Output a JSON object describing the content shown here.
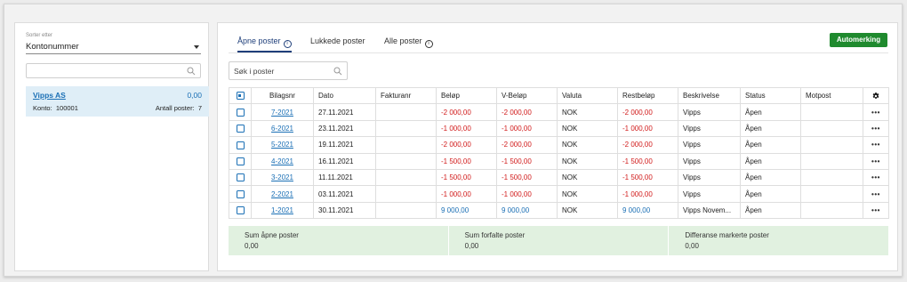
{
  "sidebar": {
    "sort_label": "Sorter etter",
    "sort_value": "Kontonummer",
    "search_placeholder": "",
    "account": {
      "name": "Vipps AS",
      "sum": "0,00",
      "konto_label": "Konto:",
      "konto_value": "100001",
      "count_label": "Antall poster:",
      "count_value": "7"
    }
  },
  "tabs": [
    {
      "label": "Åpne poster",
      "active": true,
      "info_icon": true
    },
    {
      "label": "Lukkede poster",
      "active": false,
      "info_icon": false
    },
    {
      "label": "Alle poster",
      "active": false,
      "info_icon": true
    }
  ],
  "info_glyph": "i",
  "automerking_label": "Automerking",
  "search_placeholder": "Søk i poster",
  "table": {
    "headers": [
      "Bilagsnr",
      "Dato",
      "Fakturanr",
      "Beløp",
      "V-Beløp",
      "Valuta",
      "Restbeløp",
      "Beskrivelse",
      "Status",
      "Motpost"
    ],
    "rows": [
      {
        "bilagsnr": "7-2021",
        "dato": "27.11.2021",
        "fakturanr": "",
        "belop": "-2 000,00",
        "vbelop": "-2 000,00",
        "valuta": "NOK",
        "restbelop": "-2 000,00",
        "beskrivelse": "Vipps",
        "status": "Åpen",
        "motpost": ""
      },
      {
        "bilagsnr": "6-2021",
        "dato": "23.11.2021",
        "fakturanr": "",
        "belop": "-1 000,00",
        "vbelop": "-1 000,00",
        "valuta": "NOK",
        "restbelop": "-1 000,00",
        "beskrivelse": "Vipps",
        "status": "Åpen",
        "motpost": ""
      },
      {
        "bilagsnr": "5-2021",
        "dato": "19.11.2021",
        "fakturanr": "",
        "belop": "-2 000,00",
        "vbelop": "-2 000,00",
        "valuta": "NOK",
        "restbelop": "-2 000,00",
        "beskrivelse": "Vipps",
        "status": "Åpen",
        "motpost": ""
      },
      {
        "bilagsnr": "4-2021",
        "dato": "16.11.2021",
        "fakturanr": "",
        "belop": "-1 500,00",
        "vbelop": "-1 500,00",
        "valuta": "NOK",
        "restbelop": "-1 500,00",
        "beskrivelse": "Vipps",
        "status": "Åpen",
        "motpost": ""
      },
      {
        "bilagsnr": "3-2021",
        "dato": "11.11.2021",
        "fakturanr": "",
        "belop": "-1 500,00",
        "vbelop": "-1 500,00",
        "valuta": "NOK",
        "restbelop": "-1 500,00",
        "beskrivelse": "Vipps",
        "status": "Åpen",
        "motpost": ""
      },
      {
        "bilagsnr": "2-2021",
        "dato": "03.11.2021",
        "fakturanr": "",
        "belop": "-1 000,00",
        "vbelop": "-1 000,00",
        "valuta": "NOK",
        "restbelop": "-1 000,00",
        "beskrivelse": "Vipps",
        "status": "Åpen",
        "motpost": ""
      },
      {
        "bilagsnr": "1-2021",
        "dato": "30.11.2021",
        "fakturanr": "",
        "belop": "9 000,00",
        "vbelop": "9 000,00",
        "valuta": "NOK",
        "restbelop": "9 000,00",
        "beskrivelse": "Vipps Novem...",
        "status": "Åpen",
        "motpost": ""
      }
    ],
    "row_menu_glyph": "•••"
  },
  "summary": [
    {
      "label": "Sum åpne poster",
      "value": "0,00"
    },
    {
      "label": "Sum forfalte poster",
      "value": "0,00"
    },
    {
      "label": "Differanse markerte poster",
      "value": "0,00"
    }
  ],
  "colors": {
    "accent": "#1a6fb5",
    "negative": "#d11a1a",
    "button_green": "#1f8a2e",
    "summary_bg": "#e1f1e0",
    "selected_account_bg": "#dfeef7"
  }
}
